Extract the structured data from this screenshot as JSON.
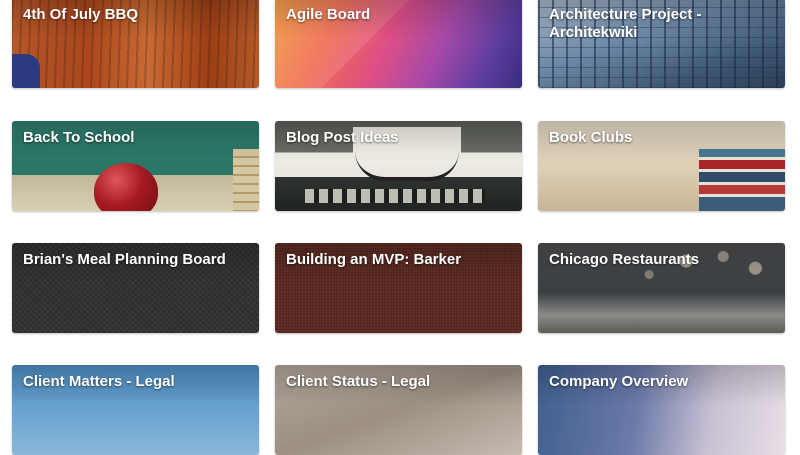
{
  "boards": [
    {
      "id": "bbq",
      "title": "4th Of July BBQ"
    },
    {
      "id": "agile",
      "title": "Agile Board"
    },
    {
      "id": "arch",
      "title": "Architecture Project - Architekwiki"
    },
    {
      "id": "school",
      "title": "Back To School"
    },
    {
      "id": "blog",
      "title": "Blog Post Ideas"
    },
    {
      "id": "books",
      "title": "Book Clubs"
    },
    {
      "id": "meal",
      "title": "Brian's Meal Planning Board"
    },
    {
      "id": "mvp",
      "title": "Building an MVP: Barker"
    },
    {
      "id": "chicago",
      "title": "Chicago Restaurants"
    },
    {
      "id": "legal",
      "title": "Client Matters - Legal"
    },
    {
      "id": "status",
      "title": "Client Status - Legal"
    },
    {
      "id": "company",
      "title": "Company Overview"
    }
  ]
}
